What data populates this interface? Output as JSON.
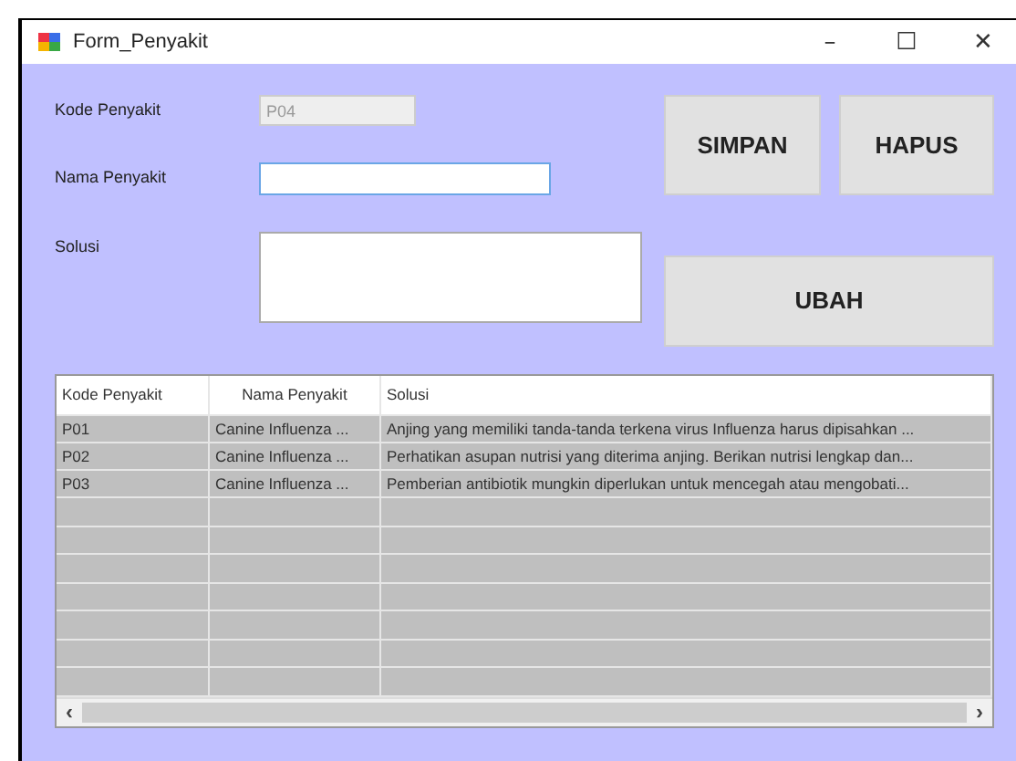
{
  "window": {
    "title": "Form_Penyakit",
    "controls": [
      "–",
      "☐",
      "✕"
    ]
  },
  "form": {
    "fields": [
      {
        "label": "Kode Penyakit",
        "value": "P04",
        "disabled": true,
        "kind": "text"
      },
      {
        "label": "Nama Penyakit",
        "disabled": false,
        "focused": true,
        "kind": "text"
      },
      {
        "label": "Solusi",
        "disabled": false,
        "focused": false,
        "kind": "multiline"
      }
    ]
  },
  "buttons": [
    "SIMPAN",
    "HAPUS",
    "UBAH"
  ],
  "table": {
    "columns": [
      "Kode Penyakit",
      "Nama Penyakit",
      "Solusi"
    ],
    "rows": [
      [
        "P01",
        "Canine Influenza ...",
        "Anjing yang memiliki tanda-tanda terkena virus Influenza harus dipisahkan ..."
      ],
      [
        "P02",
        "Canine Influenza ...",
        "Perhatikan asupan nutrisi yang diterima anjing. Berikan nutrisi lengkap dan..."
      ],
      [
        "P03",
        "Canine Influenza ...",
        "Pemberian antibiotik mungkin diperlukan untuk mencegah atau mengobati..."
      ]
    ],
    "scrollbar": {
      "left": "‹",
      "right": "›"
    }
  }
}
